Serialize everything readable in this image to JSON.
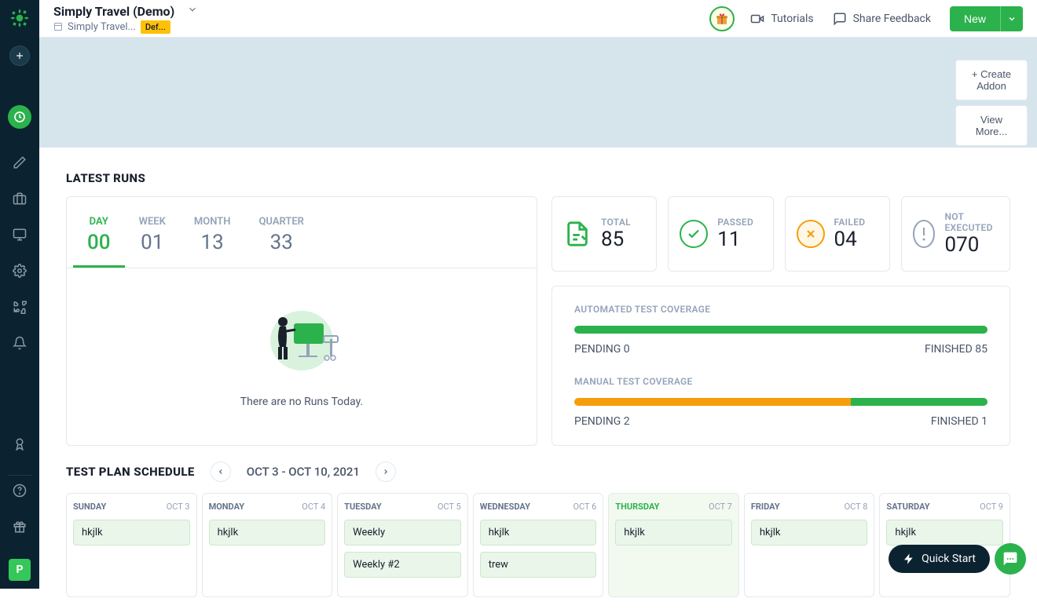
{
  "header": {
    "project_title": "Simply Travel (Demo)",
    "project_sub": "Simply Travel...",
    "def_badge": "Def...",
    "tutorials": "Tutorials",
    "share_feedback": "Share Feedback",
    "new_button": "New"
  },
  "blue_panel": {
    "create_addon": "+ Create Addon",
    "view_more": "View More..."
  },
  "latest_runs": {
    "title": "LATEST RUNS",
    "tabs": [
      {
        "label": "DAY",
        "value": "00"
      },
      {
        "label": "WEEK",
        "value": "01"
      },
      {
        "label": "MONTH",
        "value": "13"
      },
      {
        "label": "QUARTER",
        "value": "33"
      }
    ],
    "active_tab_index": 0,
    "empty_text": "There are no Runs Today.",
    "stats": {
      "total": {
        "label": "TOTAL",
        "value": "85"
      },
      "passed": {
        "label": "PASSED",
        "value": "11"
      },
      "failed": {
        "label": "FAILED",
        "value": "04"
      },
      "not_executed": {
        "label": "NOT EXECUTED",
        "value": "070"
      }
    }
  },
  "coverage": {
    "automated": {
      "title": "AUTOMATED TEST COVERAGE",
      "pending": "PENDING 0",
      "finished": "FINISHED 85",
      "percent_finished": 100
    },
    "manual": {
      "title": "MANUAL TEST COVERAGE",
      "pending": "PENDING 2",
      "finished": "FINISHED 1",
      "percent_pending": 67,
      "percent_finished": 33
    }
  },
  "schedule": {
    "title": "TEST PLAN SCHEDULE",
    "range": "OCT 3 - OCT 10, 2021",
    "days": [
      {
        "name": "SUNDAY",
        "date": "OCT 3",
        "events": [
          "hkjlk"
        ]
      },
      {
        "name": "MONDAY",
        "date": "OCT 4",
        "events": [
          "hkjlk"
        ]
      },
      {
        "name": "TUESDAY",
        "date": "OCT 5",
        "events": [
          "Weekly",
          "Weekly #2"
        ]
      },
      {
        "name": "WEDNESDAY",
        "date": "OCT 6",
        "events": [
          "hkjlk",
          "trew"
        ]
      },
      {
        "name": "THURSDAY",
        "date": "OCT 7",
        "events": [
          "hkjlk"
        ],
        "today": true
      },
      {
        "name": "FRIDAY",
        "date": "OCT 8",
        "events": [
          "hkjlk"
        ]
      },
      {
        "name": "SATURDAY",
        "date": "OCT 9",
        "events": [
          "hkjlk"
        ]
      }
    ]
  },
  "floating": {
    "quick_start": "Quick Start"
  },
  "user_badge": "P",
  "colors": {
    "accent": "#2bb24c",
    "orange": "#f59e0b"
  }
}
